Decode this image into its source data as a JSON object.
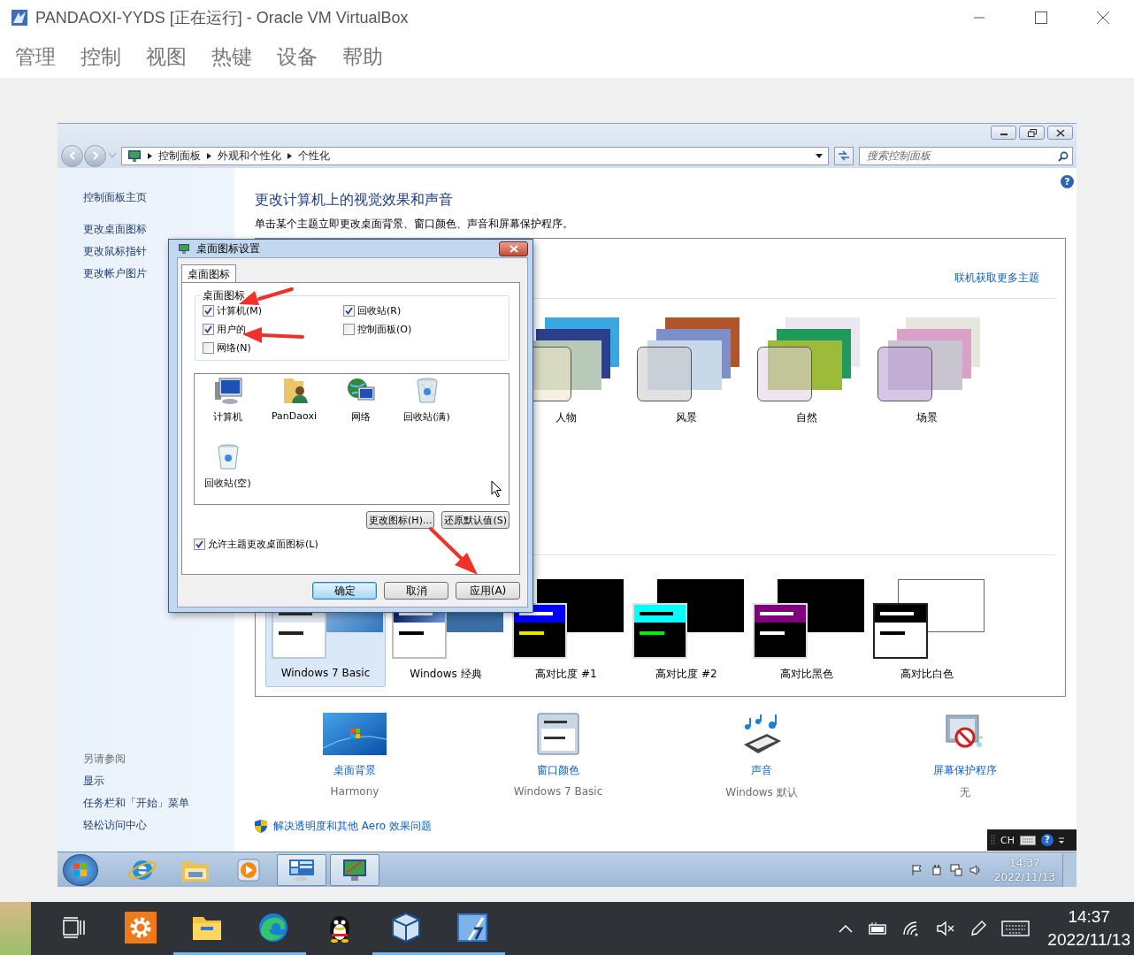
{
  "window": {
    "title": "PANDAOXI-YYDS [正在运行] - Oracle VM VirtualBox"
  },
  "menu": [
    "管理",
    "控制",
    "视图",
    "热键",
    "设备",
    "帮助"
  ],
  "guest": {
    "address_bar": {
      "breadcrumbs": [
        "控制面板",
        "外观和个性化",
        "个性化"
      ],
      "search": {
        "placeholder": "搜索控制面板"
      }
    },
    "sidebar": {
      "home": "控制面板主页",
      "tasks": [
        "更改桌面图标",
        "更改鼠标指针",
        "更改帐户图片"
      ],
      "see_also": {
        "heading": "另请参阅",
        "links": [
          "显示",
          "任务栏和「开始」菜单",
          "轻松访问中心"
        ]
      }
    },
    "main": {
      "heading": "更改计算机上的视觉效果和声音",
      "subtitle": "单击某个主题立即更改桌面背景、窗口颜色、声音和屏幕保护程序。",
      "help_icon": "?",
      "themes": {
        "online_link": "联机获取更多主题",
        "aero": [
          {
            "name": "人物"
          },
          {
            "name": "风景"
          },
          {
            "name": "自然"
          },
          {
            "name": "场景"
          }
        ],
        "basic": [
          {
            "name": "Windows 7 Basic",
            "kind": "basic",
            "selected": true
          },
          {
            "name": "Windows 经典",
            "kind": "classic",
            "selected": false
          },
          {
            "name": "高对比度 #1",
            "kind": "contrast1",
            "selected": false
          },
          {
            "name": "高对比度 #2",
            "kind": "contrast2",
            "selected": false
          },
          {
            "name": "高对比黑色",
            "kind": "contrast-black",
            "selected": false
          },
          {
            "name": "高对比白色",
            "kind": "contrast-white",
            "selected": false
          }
        ]
      },
      "settings": [
        {
          "kind": "wallpaper",
          "label": "桌面背景",
          "value": "Harmony"
        },
        {
          "kind": "window-color",
          "label": "窗口颜色",
          "value": "Windows 7 Basic"
        },
        {
          "kind": "sound",
          "label": "声音",
          "value": "Windows 默认"
        },
        {
          "kind": "screensaver",
          "label": "屏幕保护程序",
          "value": "无"
        }
      ],
      "troubleshoot_link": "解决透明度和其他 Aero 效果问题"
    },
    "dialog": {
      "title": "桌面图标设置",
      "tabs": [
        {
          "label": "桌面图标",
          "selected": true
        }
      ],
      "group_label": "桌面图标",
      "options": [
        {
          "label": "计算机(M)",
          "checked": true
        },
        {
          "label": "回收站(R)",
          "checked": true
        },
        {
          "label": "用户的",
          "checked": true
        },
        {
          "label": "控制面板(O)",
          "checked": false
        },
        {
          "label": "网络(N)",
          "checked": false
        }
      ],
      "icons": [
        {
          "kind": "computer",
          "label": "计算机"
        },
        {
          "kind": "user-folder",
          "label": "PanDaoxi"
        },
        {
          "kind": "network",
          "label": "网络"
        },
        {
          "kind": "bin-full",
          "label": "回收站(满)"
        },
        {
          "kind": "bin-empty",
          "label": "回收站(空)"
        }
      ],
      "icon_buttons": [
        "更改图标(H)...",
        "还原默认值(S)"
      ],
      "allow_themes": {
        "label": "允许主题更改桌面图标(L)",
        "checked": true
      },
      "buttons": [
        {
          "label": "确定",
          "default": true
        },
        {
          "label": "取消",
          "default": false
        },
        {
          "label": "应用(A)",
          "default": false
        }
      ]
    },
    "language_bar": {
      "language": "CH",
      "help": "?"
    },
    "taskbar": {
      "items": [
        {
          "kind": "ie",
          "open": false
        },
        {
          "kind": "explorer",
          "open": false
        },
        {
          "kind": "media-player",
          "open": false
        },
        {
          "kind": "control-panel",
          "open": true
        },
        {
          "kind": "display",
          "open": true
        }
      ],
      "clock": {
        "time": "14:37",
        "date": "2022/11/13"
      }
    }
  },
  "host_taskbar": {
    "apps": [
      {
        "kind": "task-view",
        "running": false
      },
      {
        "kind": "settings",
        "running": false
      },
      {
        "kind": "file-explorer",
        "running": true
      },
      {
        "kind": "edge",
        "running": true
      },
      {
        "kind": "qq",
        "running": false
      },
      {
        "kind": "virtualbox",
        "running": true
      },
      {
        "kind": "vm",
        "running": true
      }
    ],
    "clock": {
      "time": "14:37",
      "date": "2022/11/13"
    }
  }
}
